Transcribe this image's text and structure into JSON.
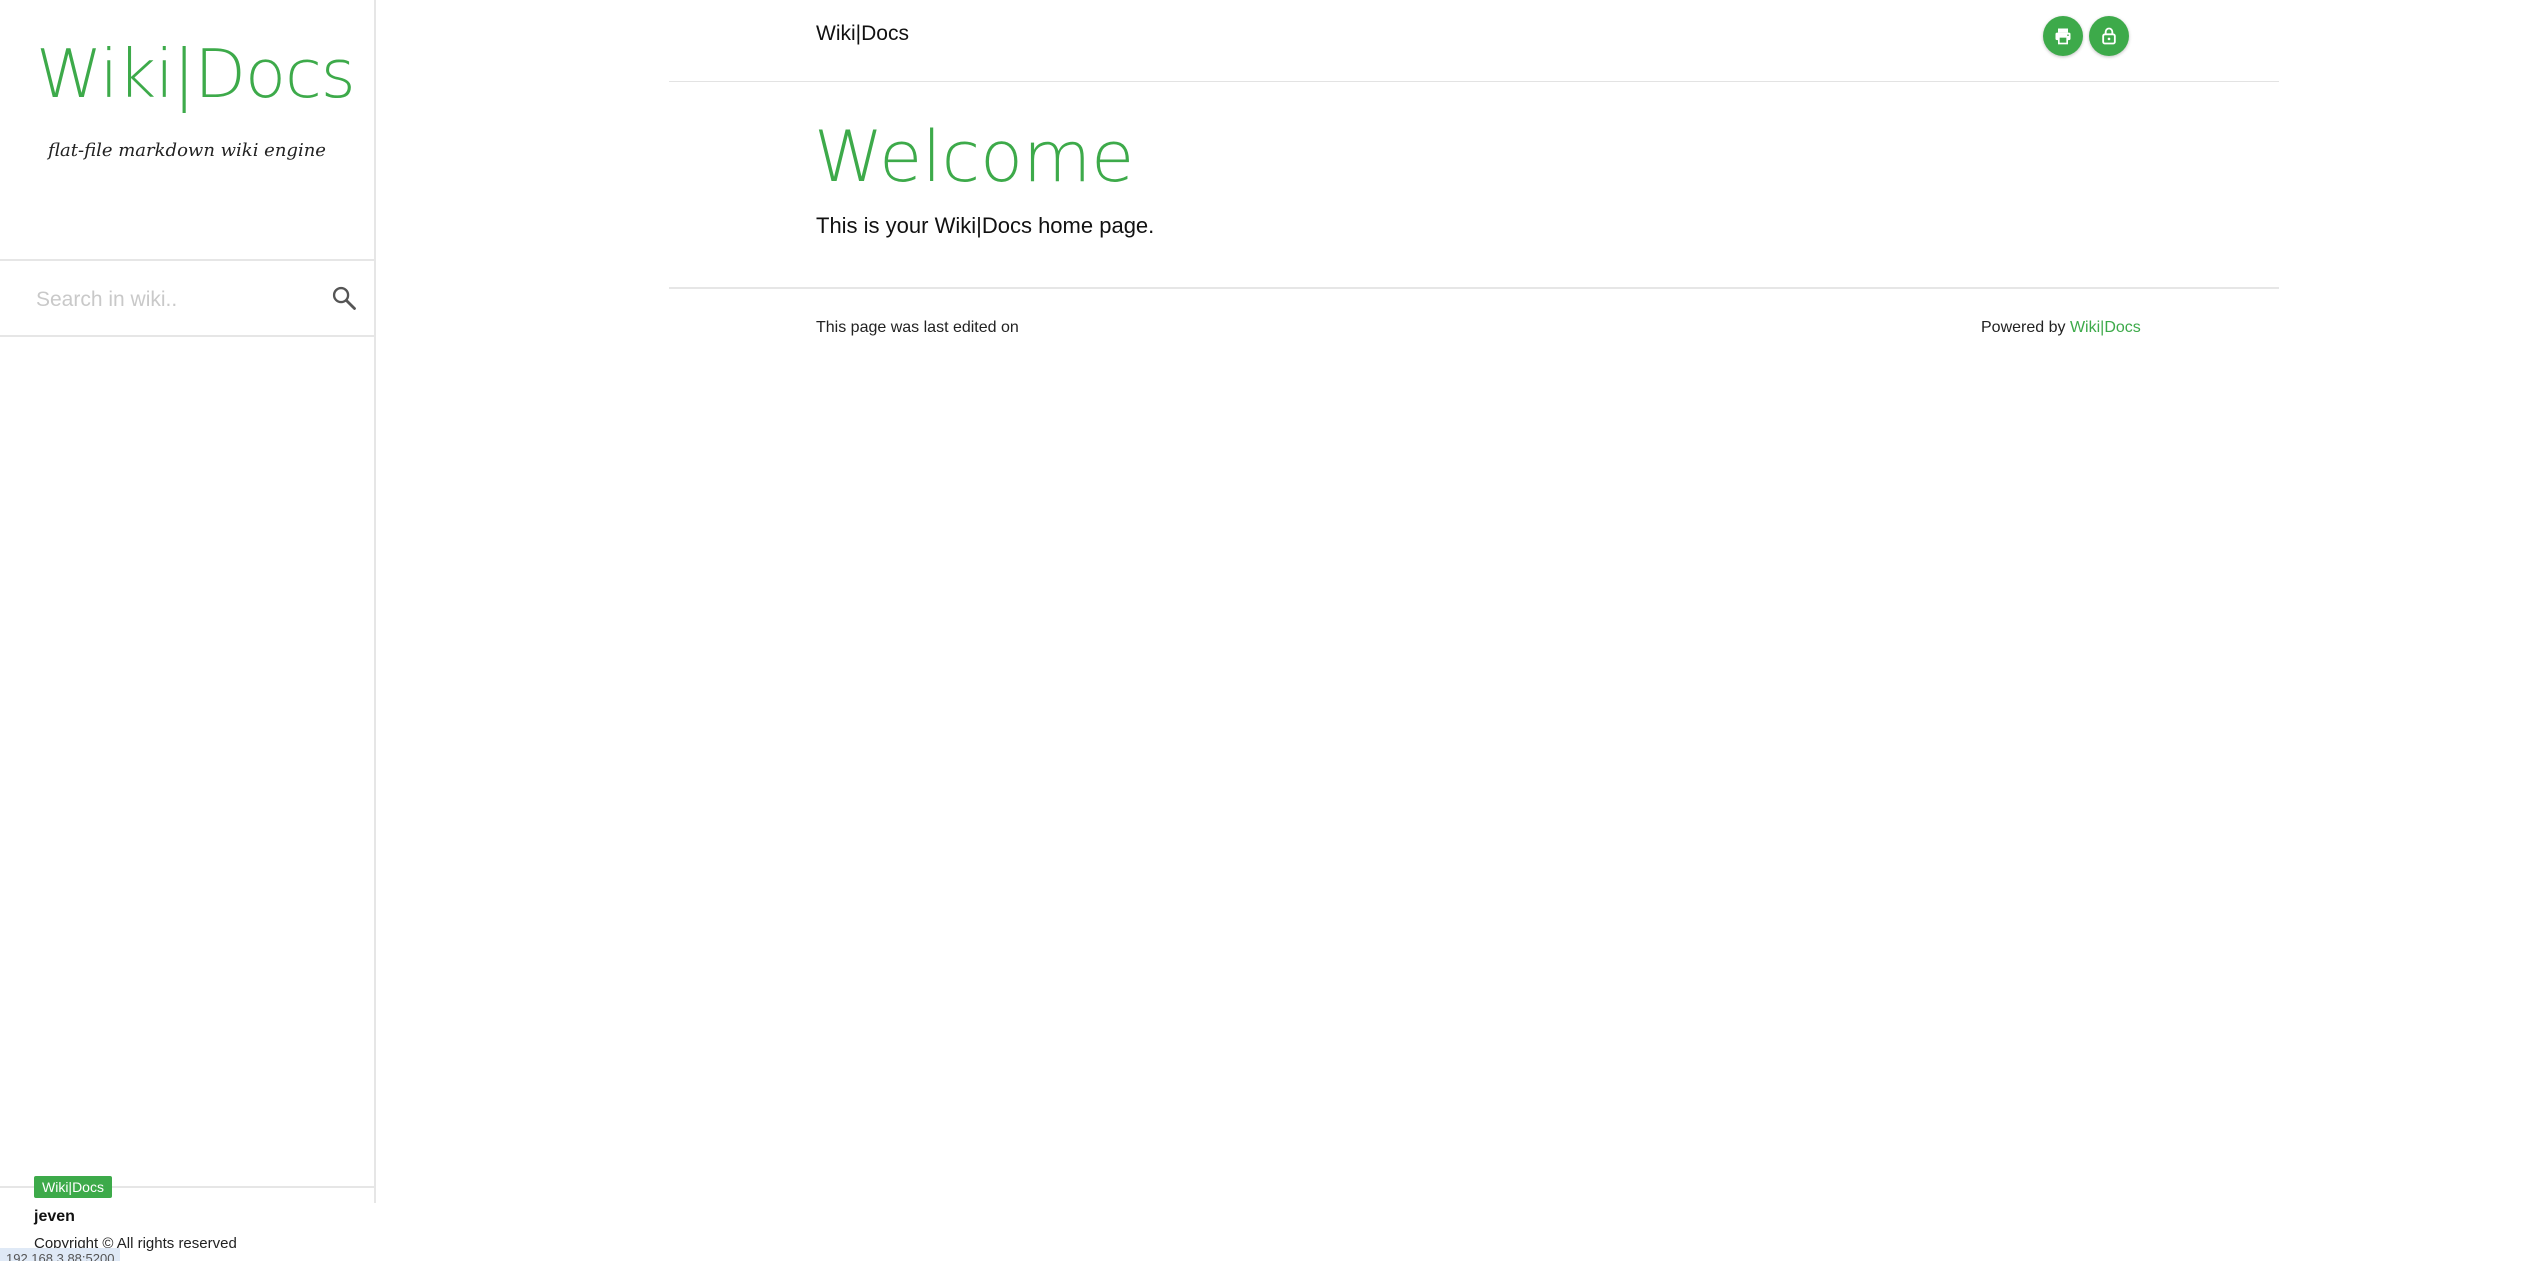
{
  "sidebar": {
    "logo": "Wiki|Docs",
    "tagline": "flat-file markdown wiki engine",
    "search": {
      "placeholder": "Search in wiki..",
      "value": ""
    },
    "footer": {
      "badge": "Wiki|Docs",
      "user": "jeven",
      "copyright": "Copyright © All rights reserved"
    }
  },
  "status_bar": {
    "text": "192.168.3.88:5200"
  },
  "header": {
    "title": "Wiki|Docs",
    "print_icon": "print-icon",
    "lock_icon": "lock-icon"
  },
  "content": {
    "heading": "Welcome",
    "body": "This is your Wiki|Docs home page."
  },
  "page_footer": {
    "last_edited": "This page was last edited on",
    "powered_prefix": "Powered by",
    "powered_link": "Wiki|Docs"
  },
  "colors": {
    "accent": "#3daa4a",
    "border": "#e6e6e6",
    "text": "#222222"
  }
}
